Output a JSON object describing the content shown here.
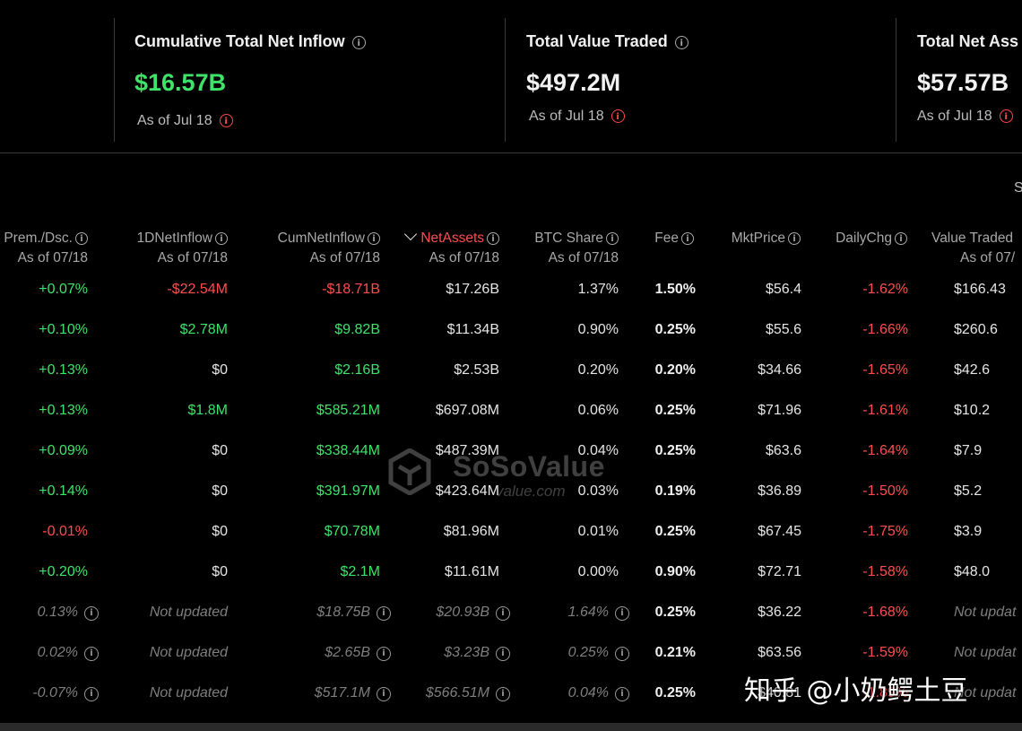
{
  "stats": [
    {
      "title": "Cumulative Total Net Inflow",
      "value": "$16.57B",
      "value_color": "#3ee36a",
      "asof": "As of Jul 18"
    },
    {
      "title": "Total Value Traded",
      "value": "$497.2M",
      "value_color": "#f2f2f2",
      "asof": "As of Jul 18"
    },
    {
      "title": "Total Net Ass",
      "value": "$57.57B",
      "value_color": "#f2f2f2",
      "asof": "As of Jul 18"
    }
  ],
  "corner_label": "S",
  "info_glyph": "i",
  "columns": [
    {
      "name": "Prem./Dsc.",
      "sub": "As of 07/18"
    },
    {
      "name": "1DNetInflow",
      "sub": "As of 07/18"
    },
    {
      "name": "CumNetInflow",
      "sub": "As of 07/18"
    },
    {
      "name": "NetAssets",
      "sub": "As of 07/18",
      "sorted": "desc"
    },
    {
      "name": "BTC Share",
      "sub": "As of 07/18"
    },
    {
      "name": "Fee",
      "sub": ""
    },
    {
      "name": "MktPrice",
      "sub": ""
    },
    {
      "name": "DailyChg",
      "sub": ""
    },
    {
      "name": "Value Traded",
      "sub": "As of 07/"
    }
  ],
  "rows": [
    {
      "prem": "+0.07%",
      "inflow": "-$22.54M",
      "cum": "-$18.71B",
      "assets": "$17.26B",
      "share": "1.37%",
      "fee": "1.50%",
      "price": "$56.4",
      "chg": "-1.62%",
      "traded": "$166.43"
    },
    {
      "prem": "+0.10%",
      "inflow": "$2.78M",
      "cum": "$9.82B",
      "assets": "$11.34B",
      "share": "0.90%",
      "fee": "0.25%",
      "price": "$55.6",
      "chg": "-1.66%",
      "traded": "$260.6"
    },
    {
      "prem": "+0.13%",
      "inflow": "$0",
      "cum": "$2.16B",
      "assets": "$2.53B",
      "share": "0.20%",
      "fee": "0.20%",
      "price": "$34.66",
      "chg": "-1.65%",
      "traded": "$42.6"
    },
    {
      "prem": "+0.13%",
      "inflow": "$1.8M",
      "cum": "$585.21M",
      "assets": "$697.08M",
      "share": "0.06%",
      "fee": "0.25%",
      "price": "$71.96",
      "chg": "-1.61%",
      "traded": "$10.2"
    },
    {
      "prem": "+0.09%",
      "inflow": "$0",
      "cum": "$338.44M",
      "assets": "$487.39M",
      "share": "0.04%",
      "fee": "0.25%",
      "price": "$63.6",
      "chg": "-1.64%",
      "traded": "$7.9"
    },
    {
      "prem": "+0.14%",
      "inflow": "$0",
      "cum": "$391.97M",
      "assets": "$423.64M",
      "share": "0.03%",
      "fee": "0.19%",
      "price": "$36.89",
      "chg": "-1.50%",
      "traded": "$5.2"
    },
    {
      "prem": "-0.01%",
      "inflow": "$0",
      "cum": "$70.78M",
      "assets": "$81.96M",
      "share": "0.01%",
      "fee": "0.25%",
      "price": "$67.45",
      "chg": "-1.75%",
      "traded": "$3.9"
    },
    {
      "prem": "+0.20%",
      "inflow": "$0",
      "cum": "$2.1M",
      "assets": "$11.61M",
      "share": "0.00%",
      "fee": "0.90%",
      "price": "$72.71",
      "chg": "-1.58%",
      "traded": "$48.0"
    },
    {
      "prem": "0.13%",
      "inflow": "Not updated",
      "cum": "$18.75B",
      "assets": "$20.93B",
      "share": "1.64%",
      "fee": "0.25%",
      "price": "$36.22",
      "chg": "-1.68%",
      "traded": "Not updat",
      "stale": true
    },
    {
      "prem": "0.02%",
      "inflow": "Not updated",
      "cum": "$2.65B",
      "assets": "$3.23B",
      "share": "0.25%",
      "fee": "0.21%",
      "price": "$63.56",
      "chg": "-1.59%",
      "traded": "Not updat",
      "stale": true
    },
    {
      "prem": "-0.07%",
      "inflow": "Not updated",
      "cum": "$517.1M",
      "assets": "$566.51M",
      "share": "0.04%",
      "fee": "0.25%",
      "price": "$40.81",
      "chg": "-1.89%",
      "traded": "Not updat",
      "stale": true
    }
  ],
  "colors": {
    "positive": "#3ee36a",
    "negative": "#ff4d4d",
    "muted": "#7f7f7f",
    "background": "#000000"
  },
  "watermark": {
    "logo_icon": "sosovalue-cube-icon",
    "text": "SoSoValue",
    "url": "value.com"
  },
  "overlay_caption": "知乎 @小奶鳄土豆"
}
